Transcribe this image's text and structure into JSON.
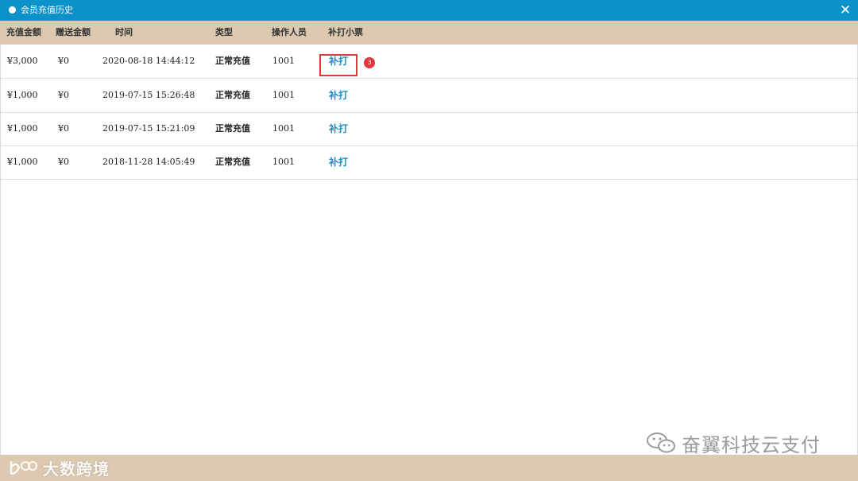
{
  "window": {
    "title": "会员充值历史",
    "close_glyph": "✕"
  },
  "table": {
    "headers": [
      "充值金额",
      "赠送金额",
      "时间",
      "类型",
      "操作人员",
      "补打小票"
    ],
    "rows": [
      {
        "amount": "¥3,000",
        "bonus": "¥0",
        "time": "2020-08-18 14:44:12",
        "type": "正常充值",
        "operator": "1001",
        "action": "补打"
      },
      {
        "amount": "¥1,000",
        "bonus": "¥0",
        "time": "2019-07-15 15:26:48",
        "type": "正常充值",
        "operator": "1001",
        "action": "补打"
      },
      {
        "amount": "¥1,000",
        "bonus": "¥0",
        "time": "2019-07-15 15:21:09",
        "type": "正常充值",
        "operator": "1001",
        "action": "补打"
      },
      {
        "amount": "¥1,000",
        "bonus": "¥0",
        "time": "2018-11-28 14:05:49",
        "type": "正常充值",
        "operator": "1001",
        "action": "补打"
      }
    ]
  },
  "annotation": {
    "badge_number": "3"
  },
  "watermarks": {
    "bottom_left": "大数跨境",
    "right": "奋翼科技云支付"
  },
  "colors": {
    "titlebar": "#0b93c9",
    "header_bg": "#dcc9b0",
    "link": "#1b8fc4",
    "highlight": "#e0373d"
  }
}
